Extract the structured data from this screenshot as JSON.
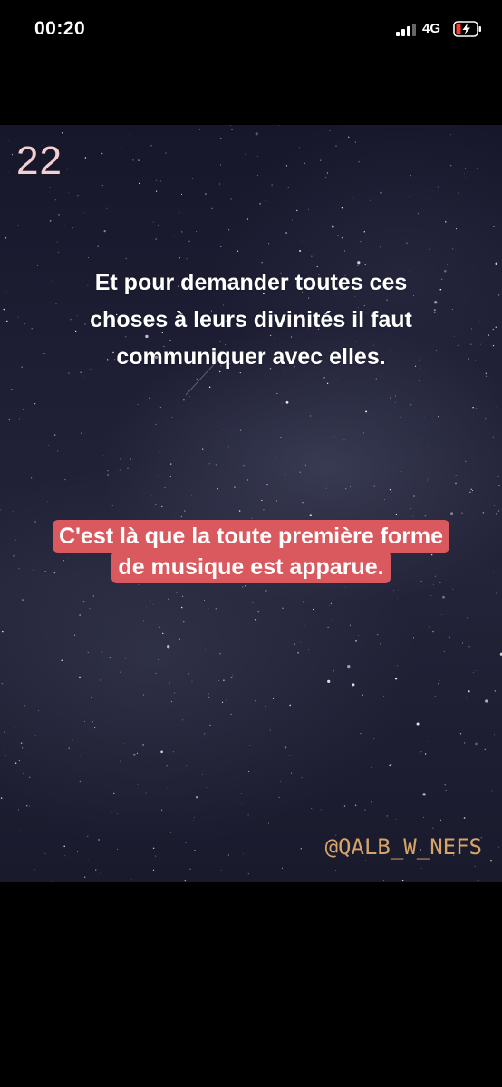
{
  "status_bar": {
    "time": "00:20",
    "network": "4G",
    "battery_state": "charging-low",
    "battery_color": "#ff3b30"
  },
  "story": {
    "page_number": "22",
    "main_text_lines": [
      "Et pour demander toutes ces",
      "choses à leurs divinités il faut",
      "communiquer avec elles."
    ],
    "highlight_lines": [
      "C'est là que la toute première forme",
      "de musique est apparue."
    ],
    "highlight_color": "#d9595e",
    "watermark": "@QALB_W_NEFS",
    "watermark_color": "#d6a467"
  }
}
